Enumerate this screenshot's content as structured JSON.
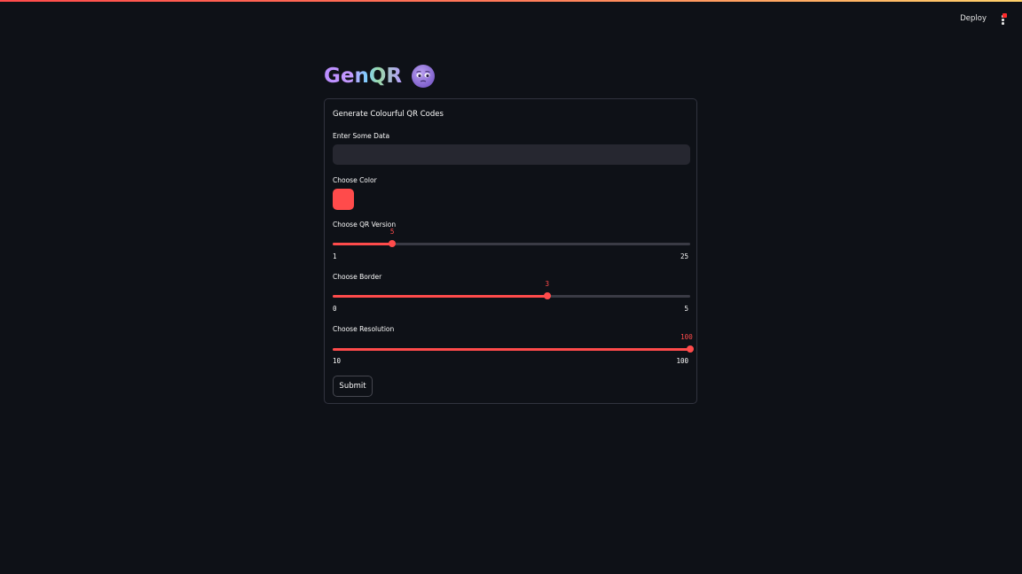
{
  "header": {
    "deploy_label": "Deploy",
    "menu_icon": "vertical-ellipsis-icon"
  },
  "app": {
    "title": "GenQR",
    "title_icon": "pleading-face-emoji"
  },
  "form": {
    "title": "Generate Colourful QR Codes",
    "data_input": {
      "label": "Enter Some Data",
      "value": "",
      "placeholder": ""
    },
    "color_picker": {
      "label": "Choose Color",
      "value": "#ff4b4b"
    },
    "sliders": [
      {
        "label": "Choose QR Version",
        "min": 1,
        "max": 25,
        "value": 5,
        "min_label": "1",
        "max_label": "25",
        "value_label": "5"
      },
      {
        "label": "Choose Border",
        "min": 0,
        "max": 5,
        "value": 3,
        "min_label": "0",
        "max_label": "5",
        "value_label": "3"
      },
      {
        "label": "Choose Resolution",
        "min": 10,
        "max": 100,
        "value": 100,
        "min_label": "10",
        "max_label": "100",
        "value_label": "100"
      }
    ],
    "submit_label": "Submit"
  },
  "colors": {
    "background": "#0e1117",
    "accent": "#ff4b4b",
    "input_bg": "#262730"
  }
}
